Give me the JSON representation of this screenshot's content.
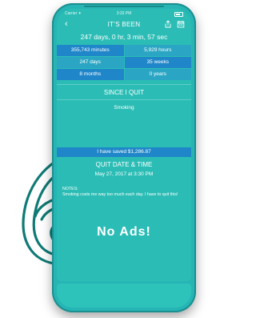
{
  "status_bar": {
    "carrier": "Carrier ✦",
    "time": "3:33 PM",
    "battery": "100%"
  },
  "nav": {
    "back_icon": "chevron-left-icon",
    "title": "IT'S BEEN",
    "share_icon": "share-icon",
    "calendar_icon": "calendar-icon"
  },
  "elapsed": "247 days, 0 hr, 3 min, 57 sec",
  "stats": [
    [
      "355,743 minutes",
      "5,929 hours"
    ],
    [
      "247 days",
      "35 weeks"
    ],
    [
      "8 months",
      "0 years"
    ]
  ],
  "since_quit": {
    "heading": "SINCE I QUIT",
    "habit": "Smoking"
  },
  "savings": "I have saved $1,286.87",
  "quit_date": {
    "heading": "QUIT DATE & TIME",
    "value": "May 27, 2017 at 3:30 PM"
  },
  "notes": {
    "label": "NOTES:",
    "text": "Smoking costs me way too much each day. I have to quit this!"
  },
  "promo": "No Ads!",
  "colors": {
    "screen_bg": "#2bbdb5",
    "stat_dark": "#1e86c9",
    "stat_light": "#2aa6c4",
    "six_outline": "#0f7a74"
  }
}
